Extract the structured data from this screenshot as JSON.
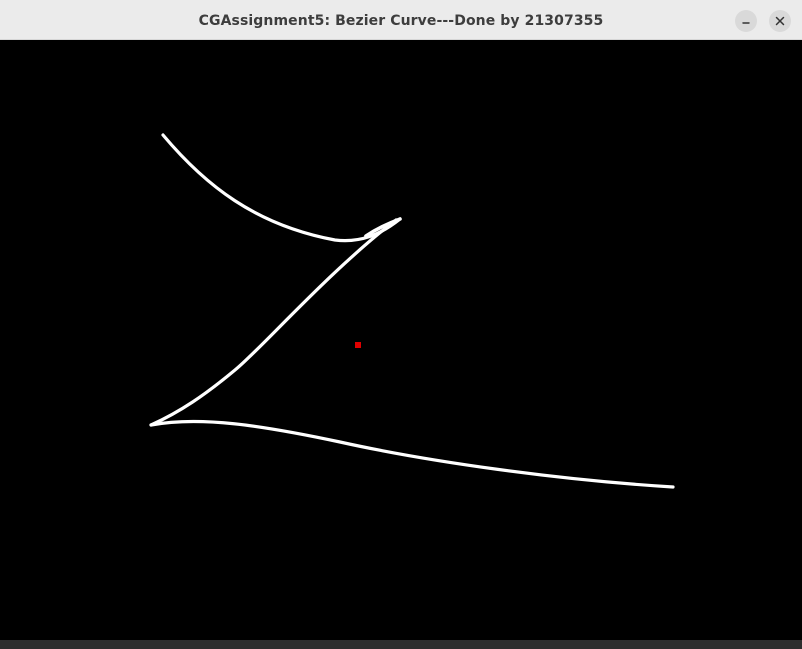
{
  "window": {
    "title": "CGAssignment5: Bezier Curve---Done by 21307355",
    "controls": {
      "minimize_icon": "minimize-icon",
      "close_icon": "close-icon"
    }
  },
  "canvas": {
    "background_color": "#000000",
    "curve_color": "#ffffff",
    "marker_color": "#e00000"
  }
}
